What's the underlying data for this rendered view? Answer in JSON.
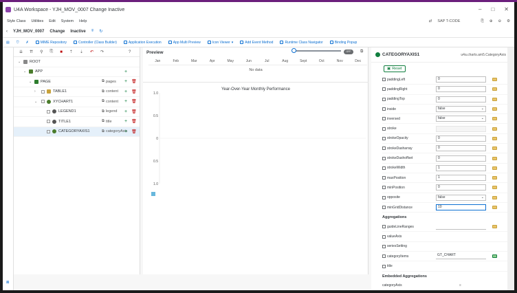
{
  "window": {
    "title": "U4A Workspace - YJH_MOV_0007 Change Inactive",
    "accent": "#6b1f7c"
  },
  "menu": {
    "items": [
      "Style Class",
      "Utilities",
      "Edit",
      "System",
      "Help"
    ],
    "tcode_placeholder": "SAP T-CODE"
  },
  "appbar": {
    "app_id": "YJH_MOV_0007",
    "mode": "Change",
    "status": "Inactive"
  },
  "toolbar": {
    "buttons": [
      "MIME Repository",
      "Controller (Class Builder)",
      "Application Execution",
      "App Multi Preview",
      "Icon Viewer",
      "Add Event Method",
      "Runtime Class Navigator",
      "Binding Popup"
    ]
  },
  "tree": {
    "rows": [
      {
        "label": "ROOT",
        "tag": "",
        "level": 0
      },
      {
        "label": "APP",
        "tag": "",
        "level": 1
      },
      {
        "label": "PAGE",
        "tag": "pages",
        "level": 2
      },
      {
        "label": "TABLE1",
        "tag": "content",
        "level": 3
      },
      {
        "label": "XYCHART1",
        "tag": "content",
        "level": 3
      },
      {
        "label": "LEGEND1",
        "tag": "legend",
        "level": 4
      },
      {
        "label": "TITLE1",
        "tag": "title",
        "level": 4
      },
      {
        "label": "CATEGORYAXIS1",
        "tag": "categoryAxis",
        "level": 4
      }
    ]
  },
  "preview": {
    "title": "Preview",
    "toggle": "OFF",
    "months": [
      "Jan",
      "Feb",
      "Mar",
      "Apr",
      "May",
      "Jun",
      "Jul",
      "Aug",
      "Sept",
      "Oct",
      "Nov",
      "Dec"
    ],
    "no_data": "No data"
  },
  "chart_data": {
    "type": "line",
    "title": "Year-Over-Year Monthly Performance",
    "y_ticks": [
      "1.0",
      "0.5",
      "0",
      "0.5",
      "1.0"
    ],
    "ylim": [
      -1,
      1
    ],
    "series": [],
    "grid": true
  },
  "properties": {
    "header": "CATEGORYAXIS1",
    "class_path": "u4a.charts.am5.CategoryAxis",
    "reset_label": "Reset",
    "rows": [
      {
        "name": "paddingLeft",
        "value": "0",
        "kind": "input"
      },
      {
        "name": "paddingRight",
        "value": "0",
        "kind": "input"
      },
      {
        "name": "paddingTop",
        "value": "0",
        "kind": "input"
      },
      {
        "name": "inside",
        "value": "false",
        "kind": "select"
      },
      {
        "name": "inversed",
        "value": "false",
        "kind": "select"
      },
      {
        "name": "stroke",
        "value": "",
        "kind": "input"
      },
      {
        "name": "strokeOpacity",
        "value": "0",
        "kind": "input"
      },
      {
        "name": "strokeDasharray",
        "value": "0",
        "kind": "input"
      },
      {
        "name": "strokeDashoffset",
        "value": "0",
        "kind": "input"
      },
      {
        "name": "strokeWidth",
        "value": "1",
        "kind": "input"
      },
      {
        "name": "maxPosition",
        "value": "1",
        "kind": "input"
      },
      {
        "name": "minPosition",
        "value": "0",
        "kind": "input"
      },
      {
        "name": "opposite",
        "value": "false",
        "kind": "select"
      },
      {
        "name": "minGridDistance",
        "value": "10",
        "kind": "input-focus"
      }
    ],
    "aggregations_title": "Aggregations",
    "aggregations": [
      {
        "name": "guideLineRanges",
        "value": ""
      },
      {
        "name": "valueAxis",
        "value": ""
      },
      {
        "name": "seriesSetting",
        "value": ""
      },
      {
        "name": "categoryItems",
        "value": "GT_CHART"
      },
      {
        "name": "title",
        "value": ""
      }
    ],
    "embedded_title": "Embedded Aggregations",
    "embedded": [
      {
        "name": "categoryAxis"
      }
    ]
  }
}
